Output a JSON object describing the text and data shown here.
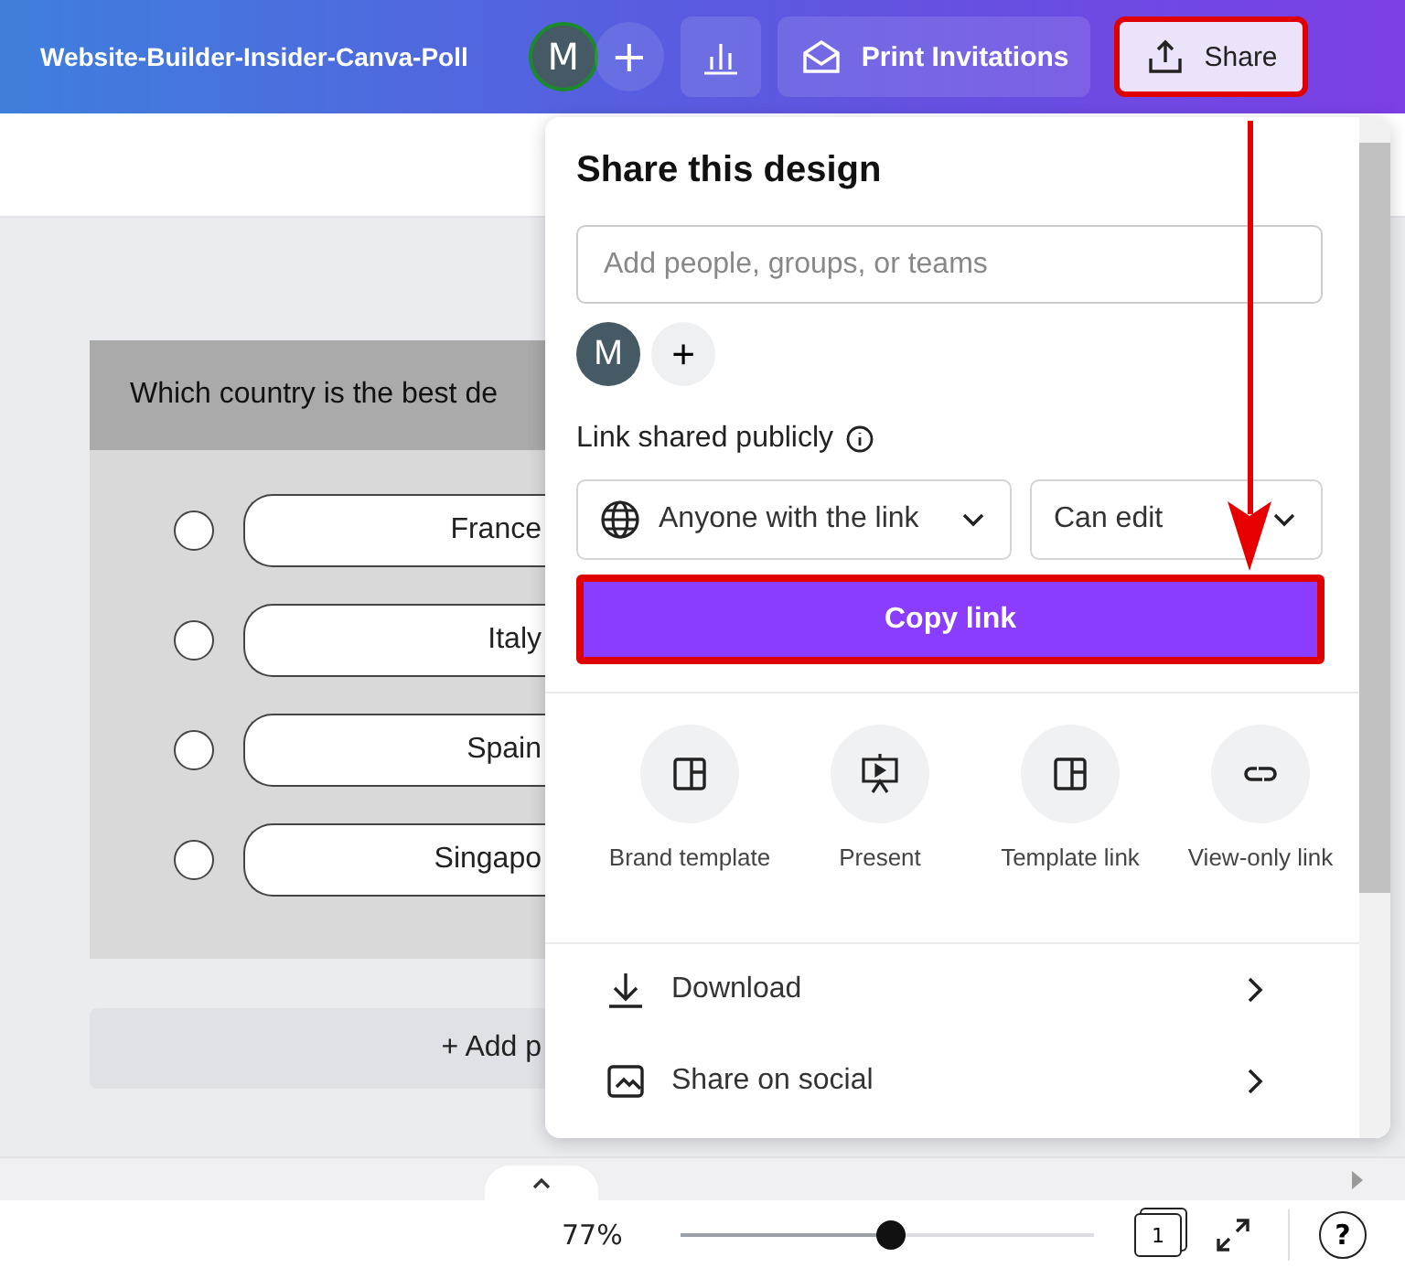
{
  "header": {
    "title": "Website-Builder-Insider-Canva-Poll",
    "avatar": "M",
    "add_member": "+",
    "buttons": [
      {
        "kind": "insights"
      },
      {
        "kind": "print",
        "label": "Print Invitations"
      },
      {
        "kind": "share",
        "label": "Share",
        "highlighted": true
      }
    ]
  },
  "poll": {
    "question": "Which country is the best de",
    "options": [
      {
        "label": "France",
        "selected": false
      },
      {
        "label": "Italy",
        "selected": false
      },
      {
        "label": "Spain",
        "selected": false
      },
      {
        "label": "Singapo",
        "selected": false
      }
    ],
    "add_button": "+ Add p"
  },
  "share_panel": {
    "title": "Share this design",
    "search": {
      "placeholder": "Add people, groups, or teams"
    },
    "avatar": "M",
    "add_person": "+",
    "link_label": "Link shared publicly",
    "access": "Anyone with the link",
    "permission": "Can edit",
    "copy_button": {
      "label": "Copy link",
      "highlighted": true
    },
    "actions": [
      {
        "kind": "brand",
        "label": "Brand template"
      },
      {
        "kind": "present",
        "label": "Present"
      },
      {
        "kind": "template",
        "label": "Template link"
      },
      {
        "kind": "viewonly",
        "label": "View-only link"
      }
    ],
    "rows": [
      {
        "kind": "download",
        "label": "Download"
      },
      {
        "kind": "social",
        "label": "Share on social"
      }
    ]
  },
  "annotation": {
    "arrow": true
  },
  "bottom_bar": {
    "zoom": "77%",
    "zoom_slider": {
      "level": 0.51
    },
    "pages": "1",
    "help": "?"
  }
}
